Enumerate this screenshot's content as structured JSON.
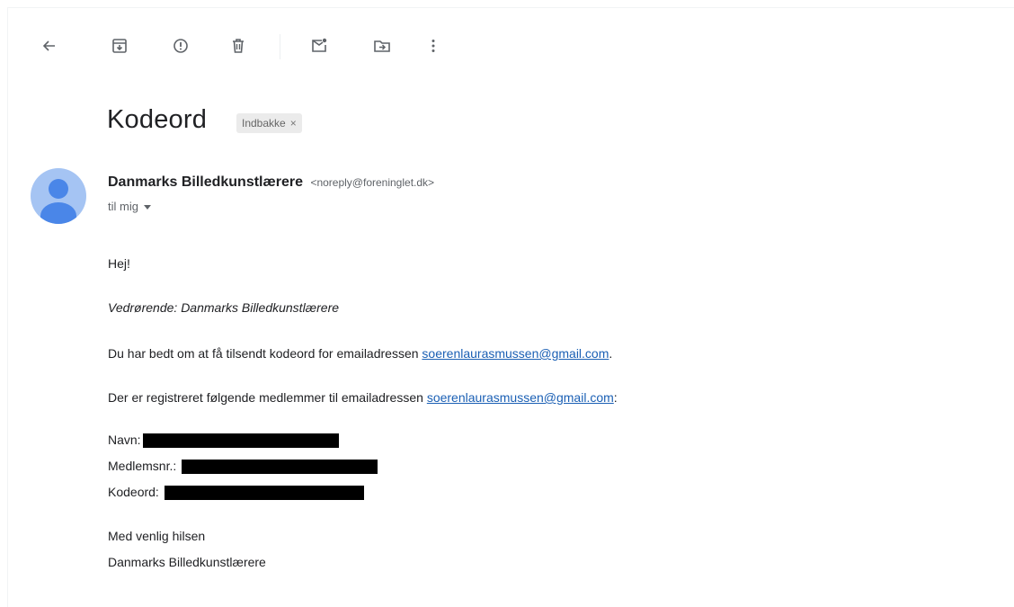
{
  "toolbar": {
    "back_icon": "arrow-left-icon",
    "archive_icon": "archive-icon",
    "spam_icon": "report-spam-icon",
    "delete_icon": "trash-icon",
    "unread_icon": "mark-unread-icon",
    "move_icon": "move-to-icon",
    "more_icon": "more-vert-icon"
  },
  "email": {
    "subject": "Kodeord",
    "label": "Indbakke",
    "label_remove": "×",
    "sender_name": "Danmarks Billedkunstlærere",
    "sender_email": "<noreply@foreninglet.dk>",
    "to": "til mig",
    "greeting": "Hej!",
    "regarding": "Vedrørende: Danmarks Billedkunstlærere",
    "line1_prefix": "Du har bedt om at få tilsendt kodeord for emailadressen ",
    "line1_email": "soerenlaurasmussen@gmail.com",
    "line1_suffix": ".",
    "line2_prefix": "Der er registreret følgende medlemmer til emailadressen ",
    "line2_email": "soerenlaurasmussen@gmail.com",
    "line2_suffix": ":",
    "name_label": "Navn:",
    "member_label": "Medlemsnr.: ",
    "code_label": "Kodeord: ",
    "signoff": "Med venlig hilsen",
    "signature": "Danmarks Billedkunstlærere"
  },
  "colors": {
    "link": "#1a5fb4",
    "avatar_bg": "#a5c4f3",
    "avatar_fg": "#4a86e8",
    "redaction": "#000000"
  }
}
